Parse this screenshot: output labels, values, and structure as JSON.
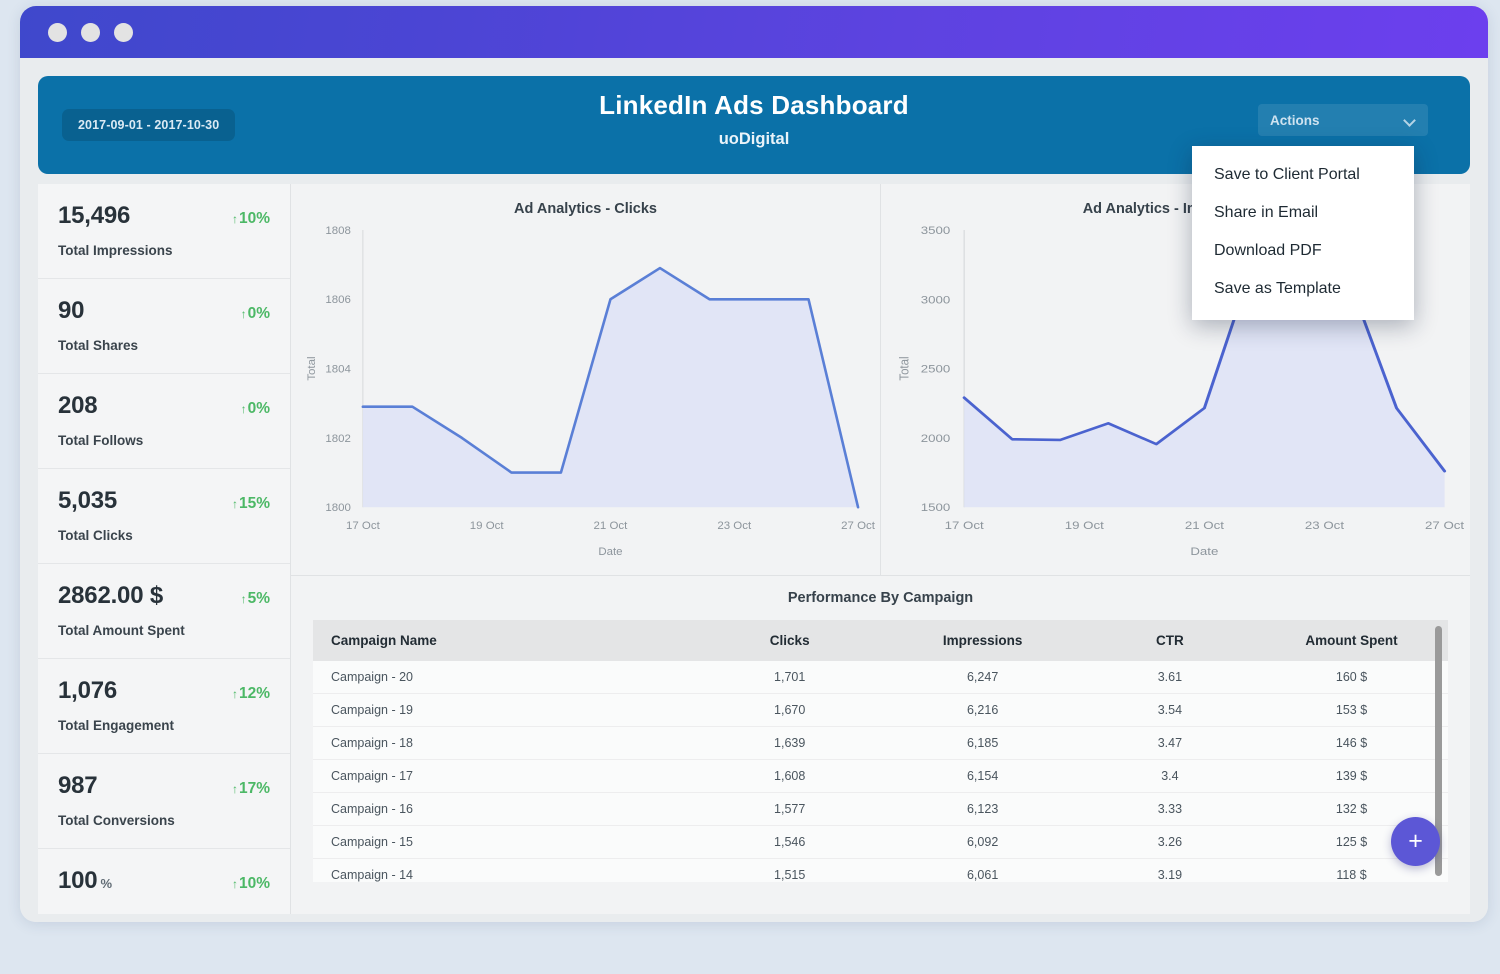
{
  "window": {
    "dots": [
      "close-dot",
      "minimize-dot",
      "maximize-dot"
    ]
  },
  "header": {
    "date_range": "2017-09-01 - 2017-10-30",
    "title": "LinkedIn Ads Dashboard",
    "subtitle": "uoDigital",
    "actions_label": "Actions",
    "accent_color": "#0b71a8"
  },
  "dropdown": {
    "open": true,
    "items": [
      "Save to Client Portal",
      "Share in Email",
      "Download PDF",
      "Save as Template"
    ]
  },
  "sidebar": {
    "kpis": [
      {
        "value": "15,496",
        "unit": "",
        "label": "Total Impressions",
        "delta": "10%",
        "arrow": "↑",
        "delta_color": "#4cb866"
      },
      {
        "value": "90",
        "unit": "",
        "label": "Total Shares",
        "delta": "0%",
        "arrow": "↑",
        "delta_color": "#4cb866"
      },
      {
        "value": "208",
        "unit": "",
        "label": "Total Follows",
        "delta": "0%",
        "arrow": "↑",
        "delta_color": "#4cb866"
      },
      {
        "value": "5,035",
        "unit": "",
        "label": "Total Clicks",
        "delta": "15%",
        "arrow": "↑",
        "delta_color": "#4cb866"
      },
      {
        "value": "2862.00 $",
        "unit": "",
        "label": "Total Amount Spent",
        "delta": "5%",
        "arrow": "↑",
        "delta_color": "#4cb866"
      },
      {
        "value": "1,076",
        "unit": "",
        "label": "Total Engagement",
        "delta": "12%",
        "arrow": "↑",
        "delta_color": "#4cb866"
      },
      {
        "value": "987",
        "unit": "",
        "label": "Total Conversions",
        "delta": "17%",
        "arrow": "↑",
        "delta_color": "#4cb866"
      },
      {
        "value": "100",
        "unit": "%",
        "label": "",
        "delta": "10%",
        "arrow": "↑",
        "delta_color": "#4cb866"
      }
    ]
  },
  "table": {
    "title": "Performance By Campaign",
    "columns": [
      "Campaign Name",
      "Clicks",
      "Impressions",
      "CTR",
      "Amount Spent"
    ],
    "rows": [
      [
        "Campaign - 20",
        "1,701",
        "6,247",
        "3.61",
        "160 $"
      ],
      [
        "Campaign - 19",
        "1,670",
        "6,216",
        "3.54",
        "153 $"
      ],
      [
        "Campaign - 18",
        "1,639",
        "6,185",
        "3.47",
        "146 $"
      ],
      [
        "Campaign - 17",
        "1,608",
        "6,154",
        "3.4",
        "139 $"
      ],
      [
        "Campaign - 16",
        "1,577",
        "6,123",
        "3.33",
        "132 $"
      ],
      [
        "Campaign - 15",
        "1,546",
        "6,092",
        "3.26",
        "125 $"
      ],
      [
        "Campaign - 14",
        "1,515",
        "6,061",
        "3.19",
        "118 $"
      ]
    ]
  },
  "fab": {
    "label": "+"
  },
  "chart_data": [
    {
      "type": "area",
      "title": "Ad Analytics - Clicks",
      "xlabel": "Date",
      "ylabel": "Total",
      "ylim": [
        1800,
        1808
      ],
      "yticks": [
        1800,
        1802,
        1804,
        1806,
        1808
      ],
      "xticks": [
        "17 Oct",
        "19 Oct",
        "21 Oct",
        "23 Oct",
        "27 Oct"
      ],
      "x": [
        "17 Oct",
        "18 Oct",
        "19 Oct",
        "20 Oct",
        "21 Oct",
        "22 Oct",
        "23 Oct",
        "24 Oct",
        "25 Oct",
        "26 Oct",
        "27 Oct"
      ],
      "values": [
        1802.9,
        1802.9,
        1802.0,
        1801.0,
        1801.0,
        1806.0,
        1806.9,
        1806.0,
        1806.0,
        1806.0,
        1800.0
      ],
      "line_color": "#5a7fd6",
      "fill_color": "#dfe4f6",
      "grid": false
    },
    {
      "type": "area",
      "title": "Ad Analytics - Impressions",
      "xlabel": "Date",
      "ylabel": "Total",
      "ylim": [
        1500,
        3500
      ],
      "yticks": [
        1500,
        2000,
        2500,
        3000,
        3500
      ],
      "xticks": [
        "17 Oct",
        "19 Oct",
        "21 Oct",
        "23 Oct",
        "27 Oct"
      ],
      "x": [
        "17 Oct",
        "18 Oct",
        "19 Oct",
        "20 Oct",
        "21 Oct",
        "22 Oct",
        "23 Oct",
        "24 Oct",
        "25 Oct",
        "26 Oct",
        "27 Oct"
      ],
      "values": [
        2290,
        1990,
        1985,
        2105,
        1955,
        2215,
        3250,
        3400,
        3150,
        2215,
        1760
      ],
      "line_color": "#4b63cf",
      "fill_color": "#dfe4f6",
      "grid": false
    }
  ]
}
